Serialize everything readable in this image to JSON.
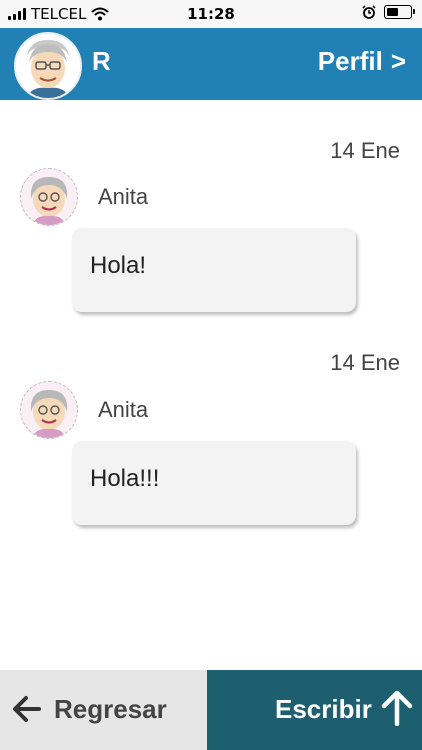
{
  "status_bar": {
    "carrier": "TELCEL",
    "time": "11:28",
    "icons": [
      "signal-icon",
      "wifi-icon",
      "alarm-icon",
      "battery-icon"
    ],
    "battery_level": 0.55
  },
  "header": {
    "contact_name": "R",
    "profile_label": "Perfil",
    "profile_chevron": ">",
    "background_color": "#2181b4"
  },
  "messages": [
    {
      "date": "14 Ene",
      "sender": "Anita",
      "text": "Hola!"
    },
    {
      "date": "14 Ene",
      "sender": "Anita",
      "text": "Hola!!!"
    }
  ],
  "bottom_bar": {
    "back_label": "Regresar",
    "write_label": "Escribir",
    "back_color": "#e6e6e6",
    "write_color": "#1e5f6f"
  }
}
